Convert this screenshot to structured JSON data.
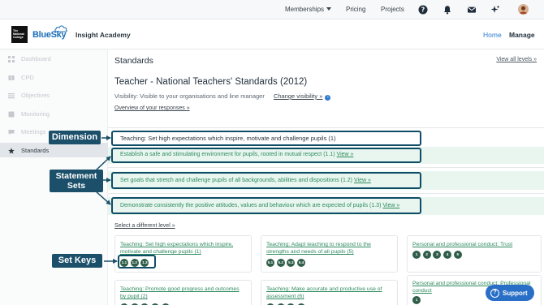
{
  "topnav": {
    "memberships": "Memberships",
    "pricing": "Pricing",
    "projects": "Projects",
    "icons": [
      "help-icon",
      "bell-icon",
      "mail-icon",
      "sparkle-icon",
      "avatar"
    ]
  },
  "header": {
    "logo_text": "The National College",
    "brand": "BlueSky",
    "academy": "Insight Academy",
    "nav": {
      "home": "Home",
      "manage": "Manage"
    }
  },
  "sidebar": {
    "items": [
      {
        "label": "Dashboard",
        "icon": "grid-icon"
      },
      {
        "label": "CPD",
        "icon": "book-icon"
      },
      {
        "label": "Objectives",
        "icon": "list-icon"
      },
      {
        "label": "Monitoring",
        "icon": "chart-icon"
      },
      {
        "label": "Meetings",
        "icon": "chat-icon"
      },
      {
        "label": "Standards",
        "icon": "star-icon"
      }
    ],
    "active": "Standards"
  },
  "main": {
    "title": "Standards",
    "view_all": "View all levels »",
    "page_title": "Teacher - National Teachers' Standards (2012)",
    "visibility_label": "Visibility:",
    "visibility_value": "Visible to your organisations and line manager",
    "change_visibility": "Change visibility »",
    "overview": "Overview of your responses »",
    "dimension": "Teaching: Set high expectations which inspire, motivate and challenge pupils (1)",
    "statement_sets": [
      {
        "text": "Establish a safe and stimulating environment for pupils, rooted in mutual respect (1.1)",
        "link": "View »"
      },
      {
        "text": "Set goals that stretch and challenge pupils of all backgrounds, abilities and dispositions (1.2)",
        "link": "View »"
      },
      {
        "text": "Demonstrate consistently the positive attitudes, values and behaviour which are expected of pupils (1.3)",
        "link": "View »"
      }
    ],
    "select_different": "Select a different level »"
  },
  "cards": [
    {
      "title_lines": [
        "Teaching: Set high expectations which inspire,",
        "motivate and challenge pupils (1)"
      ],
      "keys": [
        "1.1",
        "1.2",
        "1.3"
      ]
    },
    {
      "title_lines": [
        "Teaching: Adapt teaching to respond to the",
        "strengths and needs of all pupils (5)"
      ],
      "keys": [
        "5.1",
        "5.2",
        "5.3",
        "5.4"
      ]
    },
    {
      "title_lines": [
        "Personal and professional conduct: Trust"
      ],
      "keys": [
        "1",
        "2",
        "3",
        "4",
        "5"
      ]
    },
    {
      "title_lines": [
        "Teaching: Promote good progress and outcomes",
        "by pupil (2)"
      ],
      "keys": []
    },
    {
      "title_lines": [
        "Teaching: Make accurate and productive use of",
        "assessment (6)"
      ],
      "keys": []
    },
    {
      "title_lines": [
        "Personal and professional conduct: Professional",
        "conduct"
      ],
      "keys": [
        "1"
      ]
    }
  ],
  "annotations": {
    "dimension": "Dimension",
    "statement_sets_line1": "Statement",
    "statement_sets_line2": "Sets",
    "set_keys": "Set Keys"
  },
  "support": "Support",
  "colors": {
    "brand_blue": "#1c6fb8",
    "annotation_navy": "#1b4f6a",
    "box_outline": "#0f4d66",
    "green_link": "#2e8a5e",
    "band_bg": "#e8f6ef",
    "key_green": "#2f5e49",
    "support_blue": "#2a6fc7"
  }
}
